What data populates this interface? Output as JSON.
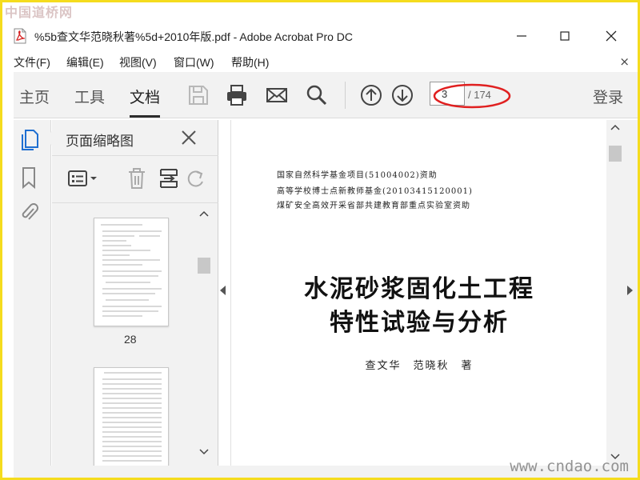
{
  "watermark": {
    "top": "中国道桥网",
    "bottom": "www.cndao.com"
  },
  "window": {
    "title": "%5b查文华范晓秋著%5d+2010年版.pdf - Adobe Acrobat Pro DC",
    "icon": "pdf-file-icon"
  },
  "menu": {
    "items": [
      "文件(F)",
      "编辑(E)",
      "视图(V)",
      "窗口(W)",
      "帮助(H)"
    ],
    "close": "×"
  },
  "toolbar": {
    "tabs": [
      "主页",
      "工具",
      "文档"
    ],
    "active_tab": "文档",
    "icons": [
      "save-icon",
      "print-icon",
      "email-icon",
      "search-icon",
      "previous-page-icon",
      "next-page-icon"
    ],
    "current_page": "3",
    "total_pages": "/ 174",
    "login": "登录",
    "highlight_color": "#e02020"
  },
  "sidebar": {
    "icons": [
      "page-thumbnails-icon",
      "bookmark-icon",
      "attachment-icon"
    ],
    "accent_color": "#1f6fd1"
  },
  "thumbnail_panel": {
    "title": "页面缩略图",
    "tool_icons": [
      "page-options-icon",
      "delete-icon",
      "insert-page-icon",
      "rotate-icon"
    ],
    "pages": [
      {
        "label": "28"
      },
      {
        "label": ""
      }
    ]
  },
  "document": {
    "funding_lines": [
      "国家自然科学基金项目(51004002)资助",
      "高等学校博士点新教师基金(20103415120001)",
      "煤矿安全高效开采省部共建教育部重点实验室资助"
    ],
    "title_lines": [
      "水泥砂浆固化土工程",
      "特性试验与分析"
    ],
    "authors": "查文华　范晓秋　著"
  }
}
